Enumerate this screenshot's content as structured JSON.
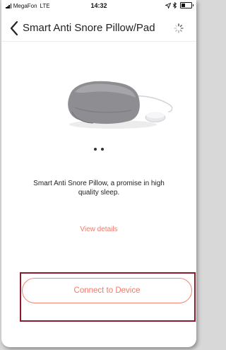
{
  "status_bar": {
    "carrier": "MegaFon",
    "network": "LTE",
    "time": "14:32",
    "battery_level": 0.4
  },
  "nav": {
    "title": "Smart Anti Snore Pillow/Pad"
  },
  "carousel": {
    "page_count": 2,
    "current_page": 1
  },
  "description": "Smart Anti Snore Pillow, a promise in high quality sleep.",
  "details_link": "View details",
  "connect_button": "Connect to Device",
  "colors": {
    "accent": "#f07a6a",
    "highlight_border": "#8b1a2a"
  },
  "icons": {
    "back": "chevron-left-icon",
    "loading": "spinner-icon",
    "location": "location-arrow-icon",
    "bluetooth": "bluetooth-icon"
  }
}
